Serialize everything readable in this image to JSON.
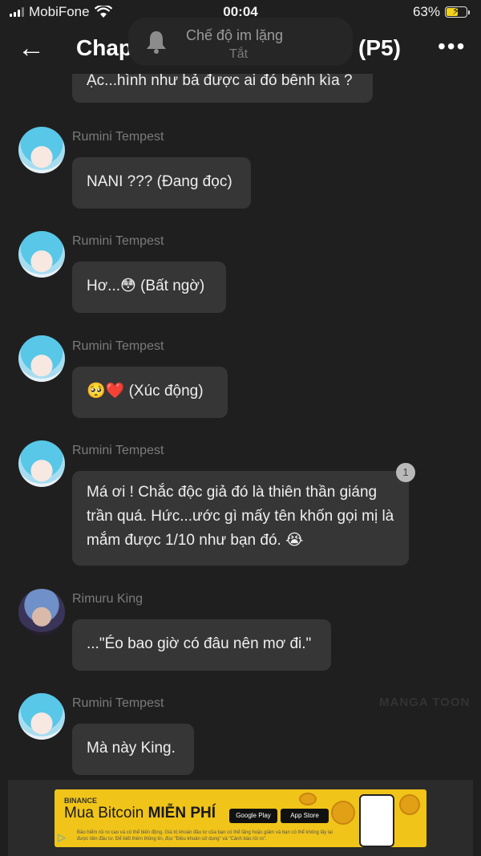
{
  "status_bar": {
    "carrier": "MobiFone",
    "time": "00:04",
    "battery": "63%",
    "battery_level": 0.63
  },
  "header": {
    "title": "Chap",
    "title_suffix": "(P5)",
    "back_icon": "arrow-left-icon",
    "more_icon": "more-dots-icon"
  },
  "toast": {
    "title": "Chế độ im lặng",
    "subtitle": "Tắt",
    "icon": "bell-icon"
  },
  "messages": [
    {
      "sender": "",
      "text": "Ặc...hình như bả được ai đó bênh kìa ?"
    },
    {
      "sender": "Rumini Tempest",
      "text": "NANI ??? (Đang đọc)"
    },
    {
      "sender": "Rumini Tempest",
      "text": "Hơ...😳 (Bất ngờ)"
    },
    {
      "sender": "Rumini Tempest",
      "text": "🥺❤️ (Xúc động)"
    },
    {
      "sender": "Rumini Tempest",
      "text": "Má ơi ! Chắc độc giả đó là thiên thần giáng trần quá. Hức...ước gì mấy tên khốn gọi mị là mắm được 1/10 như bạn đó. 😭",
      "badge": "1"
    },
    {
      "sender": "Rimuru King",
      "text": "...\"Éo bao giờ có đâu nên mơ đi.\""
    },
    {
      "sender": "Rumini Tempest",
      "text": "Mà này King."
    }
  ],
  "watermark": "MANGA TOON",
  "ad": {
    "brand": "BINANCE",
    "headline_prefix": "Mua Bitcoin",
    "headline_bold": "MIỄN PHÍ",
    "store1": "Google Play",
    "store2": "App Store",
    "fine_print": "Bảo hiểm rủi ro cao và có thể biến động. Giá trị khoản đầu tư của bạn có thể tăng hoặc giảm và bạn có thể không lấy lại được tiền đầu tư. Để biết thêm thông tin, đọc \"Điều khoản sử dụng\" và \"Cảnh báo rủi ro\".",
    "accent_color": "#f0c419"
  }
}
